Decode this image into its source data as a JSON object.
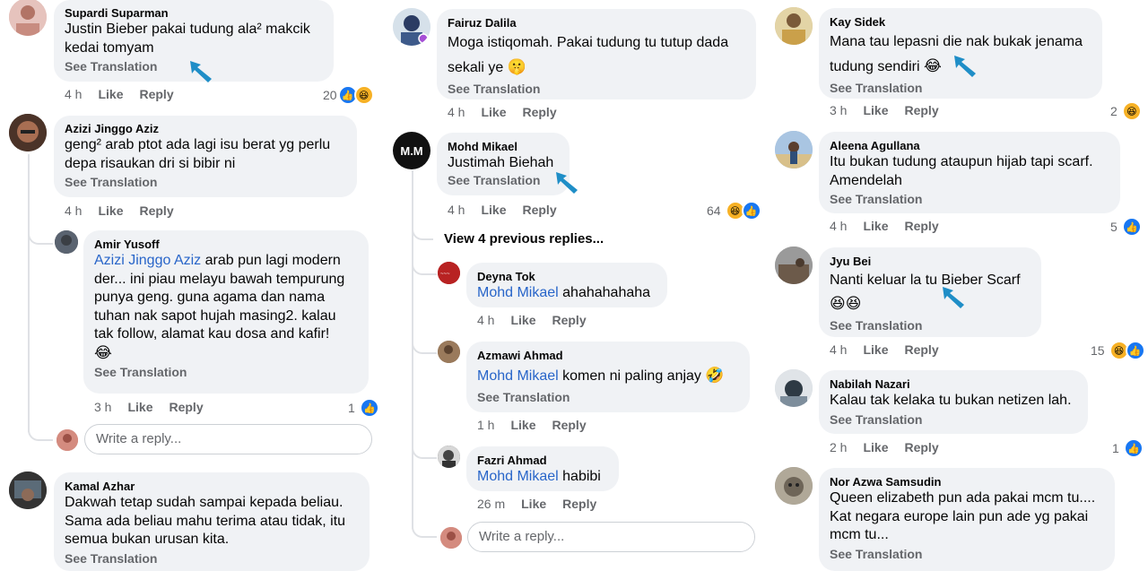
{
  "ui": {
    "see_translation": "See Translation",
    "like": "Like",
    "reply": "Reply",
    "write_reply": "Write a reply..."
  },
  "col1": {
    "c1": {
      "name": "Supardi Suparman",
      "line1": "Justin Bieber pakai tudung ala² makcik",
      "line2": "kedai tomyam",
      "time": "4 h",
      "reactions": "20"
    },
    "c2": {
      "name": "Azizi Jinggo Aziz",
      "line1": "geng² arab ptot ada lagi isu berat yg perlu",
      "line2": "depa risaukan dri si bibir ni",
      "time": "4 h"
    },
    "c3": {
      "name": "Amir Yusoff",
      "tag": "Azizi Jinggo Aziz",
      "line1": " arab pun lagi modern",
      "line2": "der... ini piau melayu bawah tempurung",
      "line3": "punya geng. guna agama dan nama",
      "line4": "tuhan nak sapot hujah masing2. kalau",
      "line5": "tak follow, alamat kau dosa and kafir!",
      "emoji": "😂",
      "time": "3 h",
      "reactions": "1"
    },
    "c4": {
      "name": "Kamal Azhar",
      "line1": "Dakwah tetap sudah sampai kepada beliau.",
      "line2": "Sama ada beliau mahu terima atau tidak, itu",
      "line3": "semua bukan urusan kita."
    }
  },
  "col2": {
    "c1": {
      "name": "Fairuz Dalila",
      "line1": "Moga istiqomah. Pakai tudung tu tutup dada",
      "line2": "sekali ye",
      "emoji": "🤫",
      "time": "4 h"
    },
    "c2": {
      "name": "Mohd Mikael",
      "avatar_text": "M.M",
      "line1": "Justimah Biehah",
      "time": "4 h",
      "reactions": "64"
    },
    "view_previous": "View 4 previous replies...",
    "r1": {
      "name": "Deyna Tok",
      "tag": "Mohd Mikael",
      "text": " ahahahahaha",
      "time": "4 h"
    },
    "r2": {
      "name": "Azmawi Ahmad",
      "tag": "Mohd Mikael",
      "text": "  komen ni paling anjay ",
      "emoji": "🤣",
      "time": "1 h"
    },
    "r3": {
      "name": "Fazri Ahmad",
      "tag": "Mohd Mikael",
      "text": " habibi",
      "time": "26 m"
    }
  },
  "col3": {
    "c1": {
      "name": "Kay Sidek",
      "line1": "Mana tau lepasni die nak bukak jenama",
      "line2": "tudung sendiri ",
      "emoji": "😂",
      "time": "3 h",
      "reactions": "2"
    },
    "c2": {
      "name": "Aleena Agullana",
      "line1": "Itu bukan tudung ataupun hijab tapi scarf.",
      "line2": "Amendelah",
      "time": "4 h",
      "reactions": "5"
    },
    "c3": {
      "name": "Jyu Bei",
      "line1": "Nanti keluar la tu Bieber Scarf",
      "emoji": "😆😆",
      "time": "4 h",
      "reactions": "15"
    },
    "c4": {
      "name": "Nabilah Nazari",
      "line1": "Kalau tak kelaka tu bukan netizen lah.",
      "time": "2 h",
      "reactions": "1"
    },
    "c5": {
      "name": "Nor Azwa Samsudin",
      "line1": "Queen elizabeth pun ada pakai mcm tu....",
      "line2": "Kat negara europe lain pun ade yg pakai",
      "line3": "mcm tu..."
    }
  },
  "colors": {
    "bubble": "#f0f2f5",
    "text": "#050505",
    "meta": "#65676b",
    "tag": "#2865c9",
    "arrow": "#1f8ec7",
    "like_blue": "#1877f2"
  }
}
